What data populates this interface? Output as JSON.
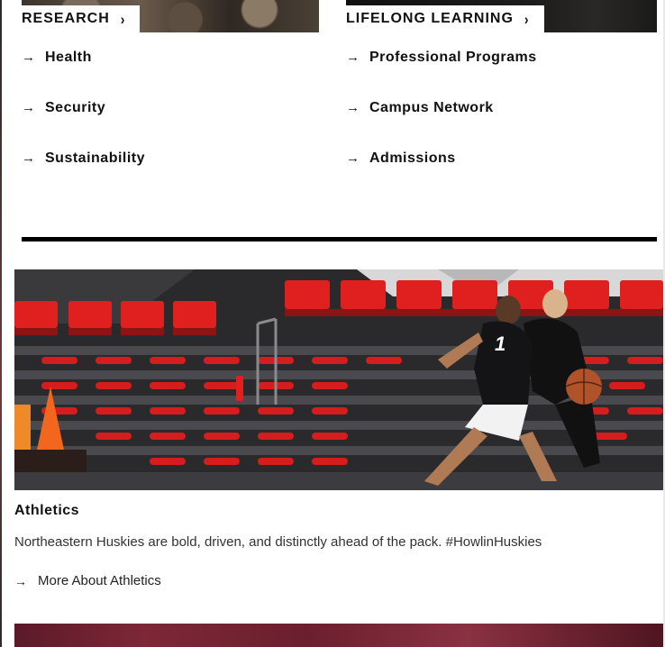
{
  "research": {
    "heading": "RESEARCH",
    "chevron": "›",
    "links": [
      {
        "label": "Health"
      },
      {
        "label": "Security"
      },
      {
        "label": "Sustainability"
      }
    ]
  },
  "lifelong": {
    "heading": "LIFELONG LEARNING",
    "chevron": "›",
    "links": [
      {
        "label": "Professional Programs"
      },
      {
        "label": "Campus Network"
      },
      {
        "label": "Admissions"
      }
    ]
  },
  "arrow_glyph": "→",
  "athletics": {
    "title": "Athletics",
    "description": "Northeastern Huskies are bold, driven, and distinctly ahead of the pack. #HowlinHuskies",
    "link_label": "More About Athletics",
    "jersey_number": "1"
  },
  "colors": {
    "seat_red": "#e0201f",
    "divider": "#000000"
  }
}
